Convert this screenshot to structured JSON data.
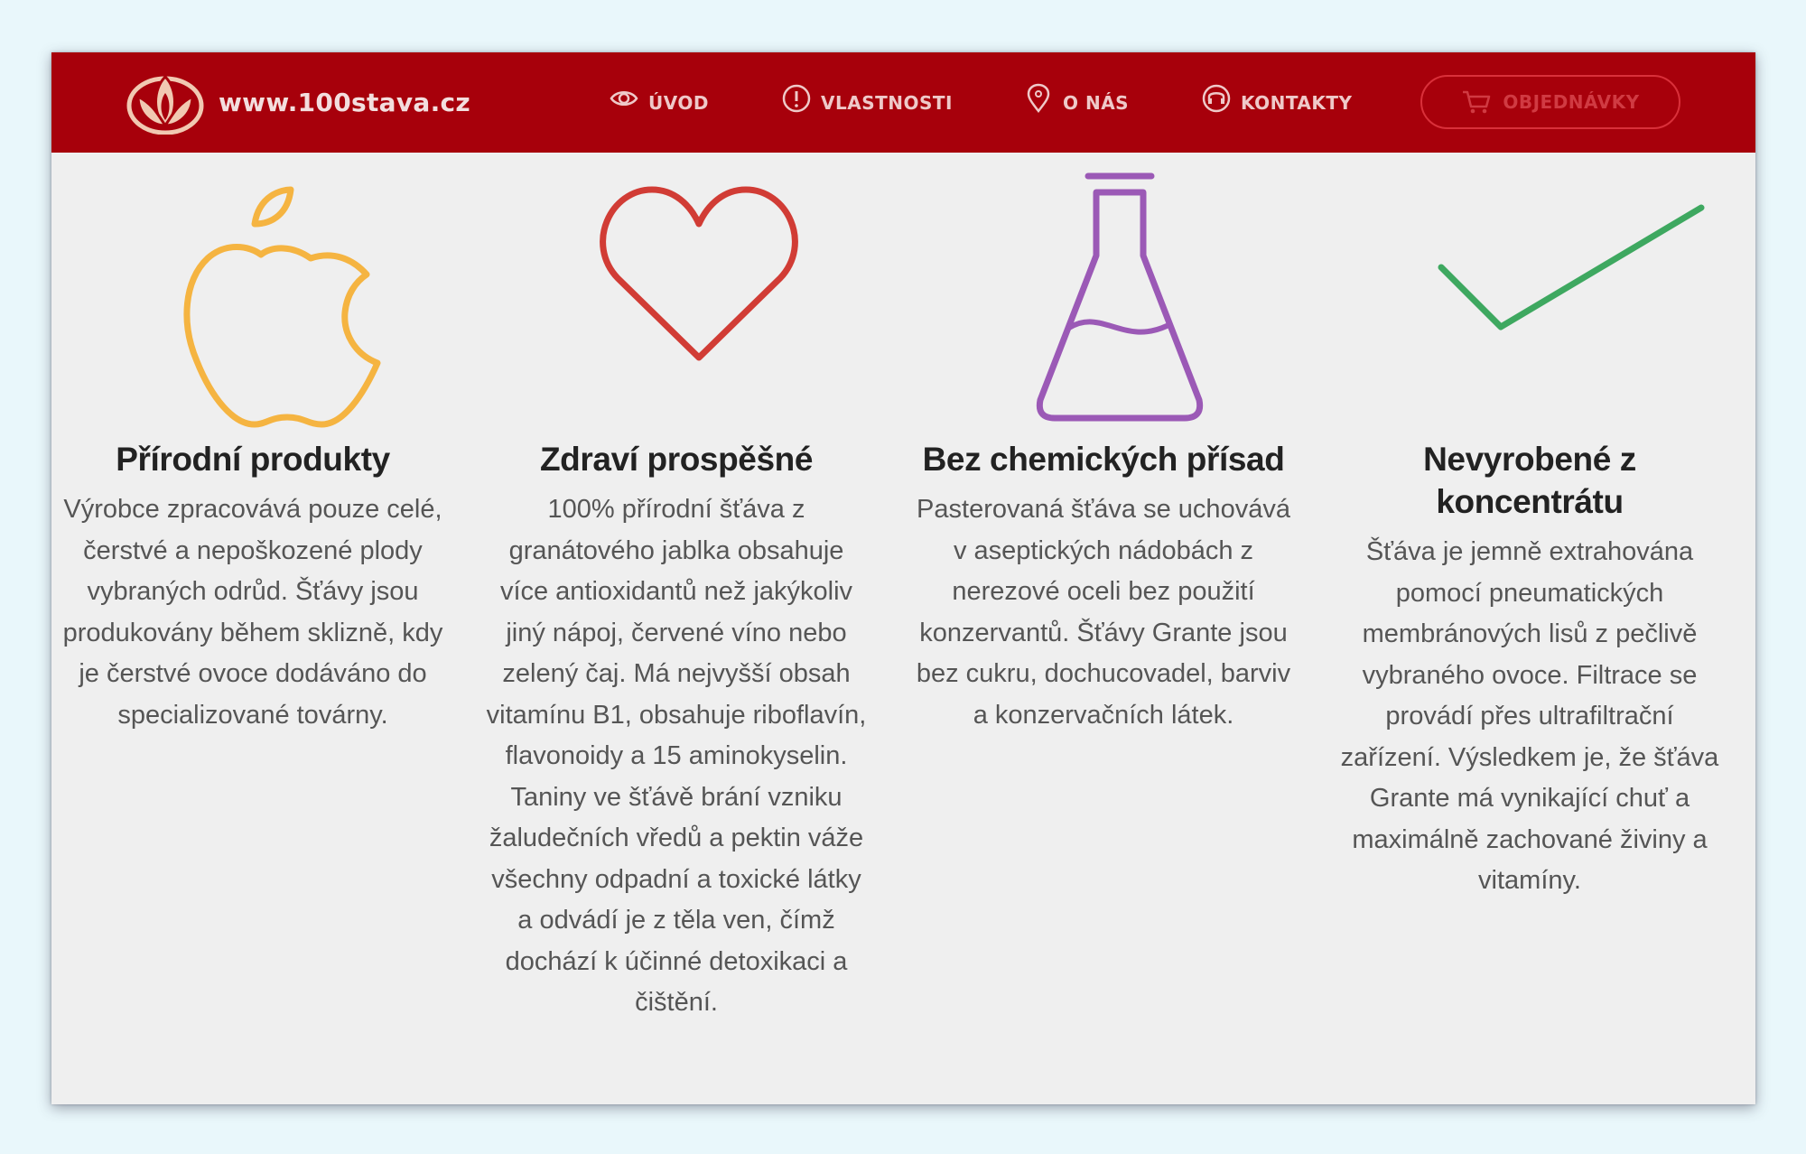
{
  "header": {
    "brand": "www.100stava.cz",
    "nav": [
      {
        "label": "ÚVOD",
        "icon": "eye-icon"
      },
      {
        "label": "VLASTNOSTI",
        "icon": "info-icon"
      },
      {
        "label": "O NÁS",
        "icon": "location-pin-icon"
      },
      {
        "label": "KONTAKTY",
        "icon": "headset-icon"
      }
    ],
    "order_button": {
      "label": "OBJEDNÁVKY",
      "icon": "cart-icon"
    }
  },
  "features": [
    {
      "title": "Přírodní produkty",
      "icon": "apple-icon",
      "color": "#f5b441",
      "text": "Výrobce zpracovává pouze celé, čerstvé a nepoškozené plody vybraných odrůd. Šťávy jsou produkovány během sklizně, kdy je čerstvé ovoce dodáváno do specializované továrny."
    },
    {
      "title": "Zdraví prospěšné",
      "icon": "heart-icon",
      "color": "#d13c35",
      "text": "100% přírodní šťáva z granátového jablka obsahuje více antioxidantů než jakýkoliv jiný nápoj, červené víno nebo zelený čaj. Má nejvyšší obsah vitamínu B1, obsahuje riboflavín, flavonoidy a 15 aminokyselin. Taniny ve šťávě brání vzniku žaludečních vředů a pektin váže všechny odpadní a toxické látky a odvádí je z těla ven, čímž dochází k účinné detoxikaci a čištění."
    },
    {
      "title": "Bez chemických přísad",
      "icon": "flask-icon",
      "color": "#9b59b6",
      "text": "Pasterovaná šťáva se uchovává v aseptických nádobách z nerezové oceli bez použití konzervantů. Šťávy Grante jsou bez cukru, dochucovadel, barviv a konzervačních látek."
    },
    {
      "title": "Nevyrobené z koncentrátu",
      "icon": "checkmark-icon",
      "color": "#3ea860",
      "text": "Šťáva je jemně extrahována pomocí pneumatických membránových lisů z pečlivě vybraného ovoce. Filtrace se provádí přes ultrafiltrační zařízení. Výsledkem je, že šťáva Grante má vynikající chuť a maximálně zachované živiny a vitamíny."
    }
  ]
}
